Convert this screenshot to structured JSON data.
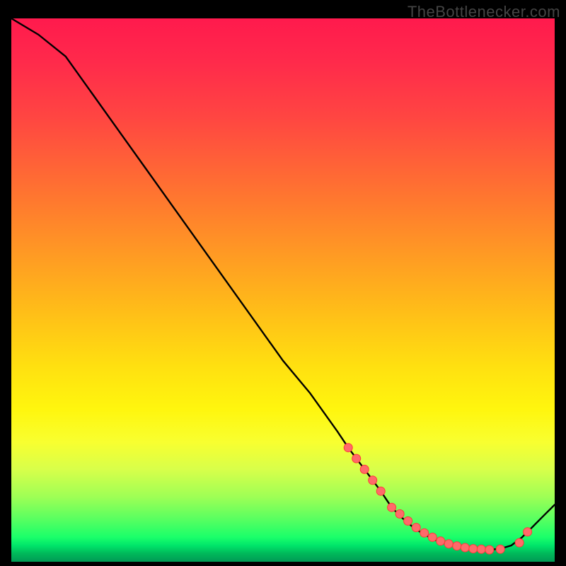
{
  "attribution": "TheBottlenecker.com",
  "chart_data": {
    "type": "line",
    "title": "",
    "xlabel": "",
    "ylabel": "",
    "xlim": [
      0,
      100
    ],
    "ylim": [
      0,
      100
    ],
    "x": [
      0,
      5,
      10,
      15,
      20,
      25,
      30,
      35,
      40,
      45,
      50,
      55,
      60,
      62,
      65,
      68,
      70,
      72,
      74,
      76,
      78,
      80,
      82,
      84,
      86,
      88,
      90,
      92,
      94,
      96,
      98,
      100
    ],
    "values": [
      100,
      97,
      93,
      86,
      79,
      72,
      65,
      58,
      51,
      44,
      37,
      31,
      24,
      21,
      17,
      13,
      10,
      8,
      6.3,
      5,
      4,
      3.3,
      2.8,
      2.5,
      2.3,
      2.2,
      2.4,
      3.0,
      4.5,
      6.5,
      8.5,
      10.5
    ],
    "markers_x": [
      62,
      63.5,
      65,
      66.5,
      68,
      70,
      71.5,
      73,
      74.5,
      76,
      77.5,
      79,
      80.5,
      82,
      83.5,
      85,
      86.5,
      88,
      90,
      93.5,
      95
    ],
    "markers_y": [
      21,
      19,
      17,
      15,
      13,
      10,
      8.8,
      7.5,
      6.3,
      5.3,
      4.5,
      3.8,
      3.3,
      2.9,
      2.6,
      2.4,
      2.3,
      2.2,
      2.3,
      3.5,
      5.5
    ]
  }
}
